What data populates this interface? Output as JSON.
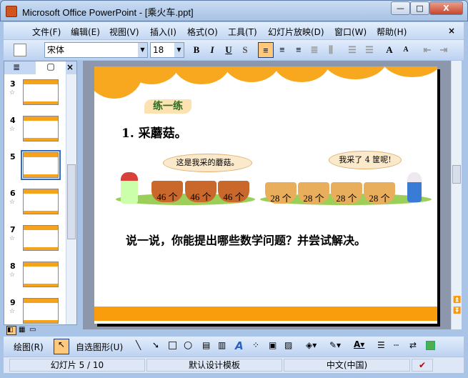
{
  "window": {
    "title": "Microsoft Office PowerPoint - [乘火车.ppt]",
    "minimize": "—",
    "maximize": "□",
    "close": "X"
  },
  "menu": [
    "文件(F)",
    "编辑(E)",
    "视图(V)",
    "插入(I)",
    "格式(O)",
    "工具(T)",
    "幻灯片放映(D)",
    "窗口(W)",
    "帮助(H)"
  ],
  "menu_close": "×",
  "toolbar": {
    "font": "宋体",
    "size": "18",
    "bold": "B",
    "italic": "I",
    "underline": "U",
    "shadow": "S",
    "grow": "A",
    "shrink": "A"
  },
  "panel": {
    "close": "×",
    "slides": [
      {
        "n": "3"
      },
      {
        "n": "4"
      },
      {
        "n": "5",
        "selected": true
      },
      {
        "n": "6"
      },
      {
        "n": "7"
      },
      {
        "n": "8"
      },
      {
        "n": "9"
      }
    ]
  },
  "slide": {
    "heading": "练一练",
    "item": "1. 采蘑菇。",
    "bubble_left": "这是我采的蘑菇。",
    "bubble_right": "我采了 4 筐呢!",
    "left_baskets": [
      "46 个",
      "46 个",
      "46 个"
    ],
    "right_baskets": [
      "28 个",
      "28 个",
      "28 个",
      "28 个"
    ],
    "question": "说一说，你能提出哪些数学问题？并尝试解决。"
  },
  "drawbar": {
    "draw": "绘图(R)",
    "autoshapes": "自选图形(U)"
  },
  "status": {
    "slide": "幻灯片 5 / 10",
    "template": "默认设计模板",
    "language": "中文(中国)"
  },
  "colors": {
    "accent": "#f8a81e",
    "highlight": "#ffc87a"
  }
}
